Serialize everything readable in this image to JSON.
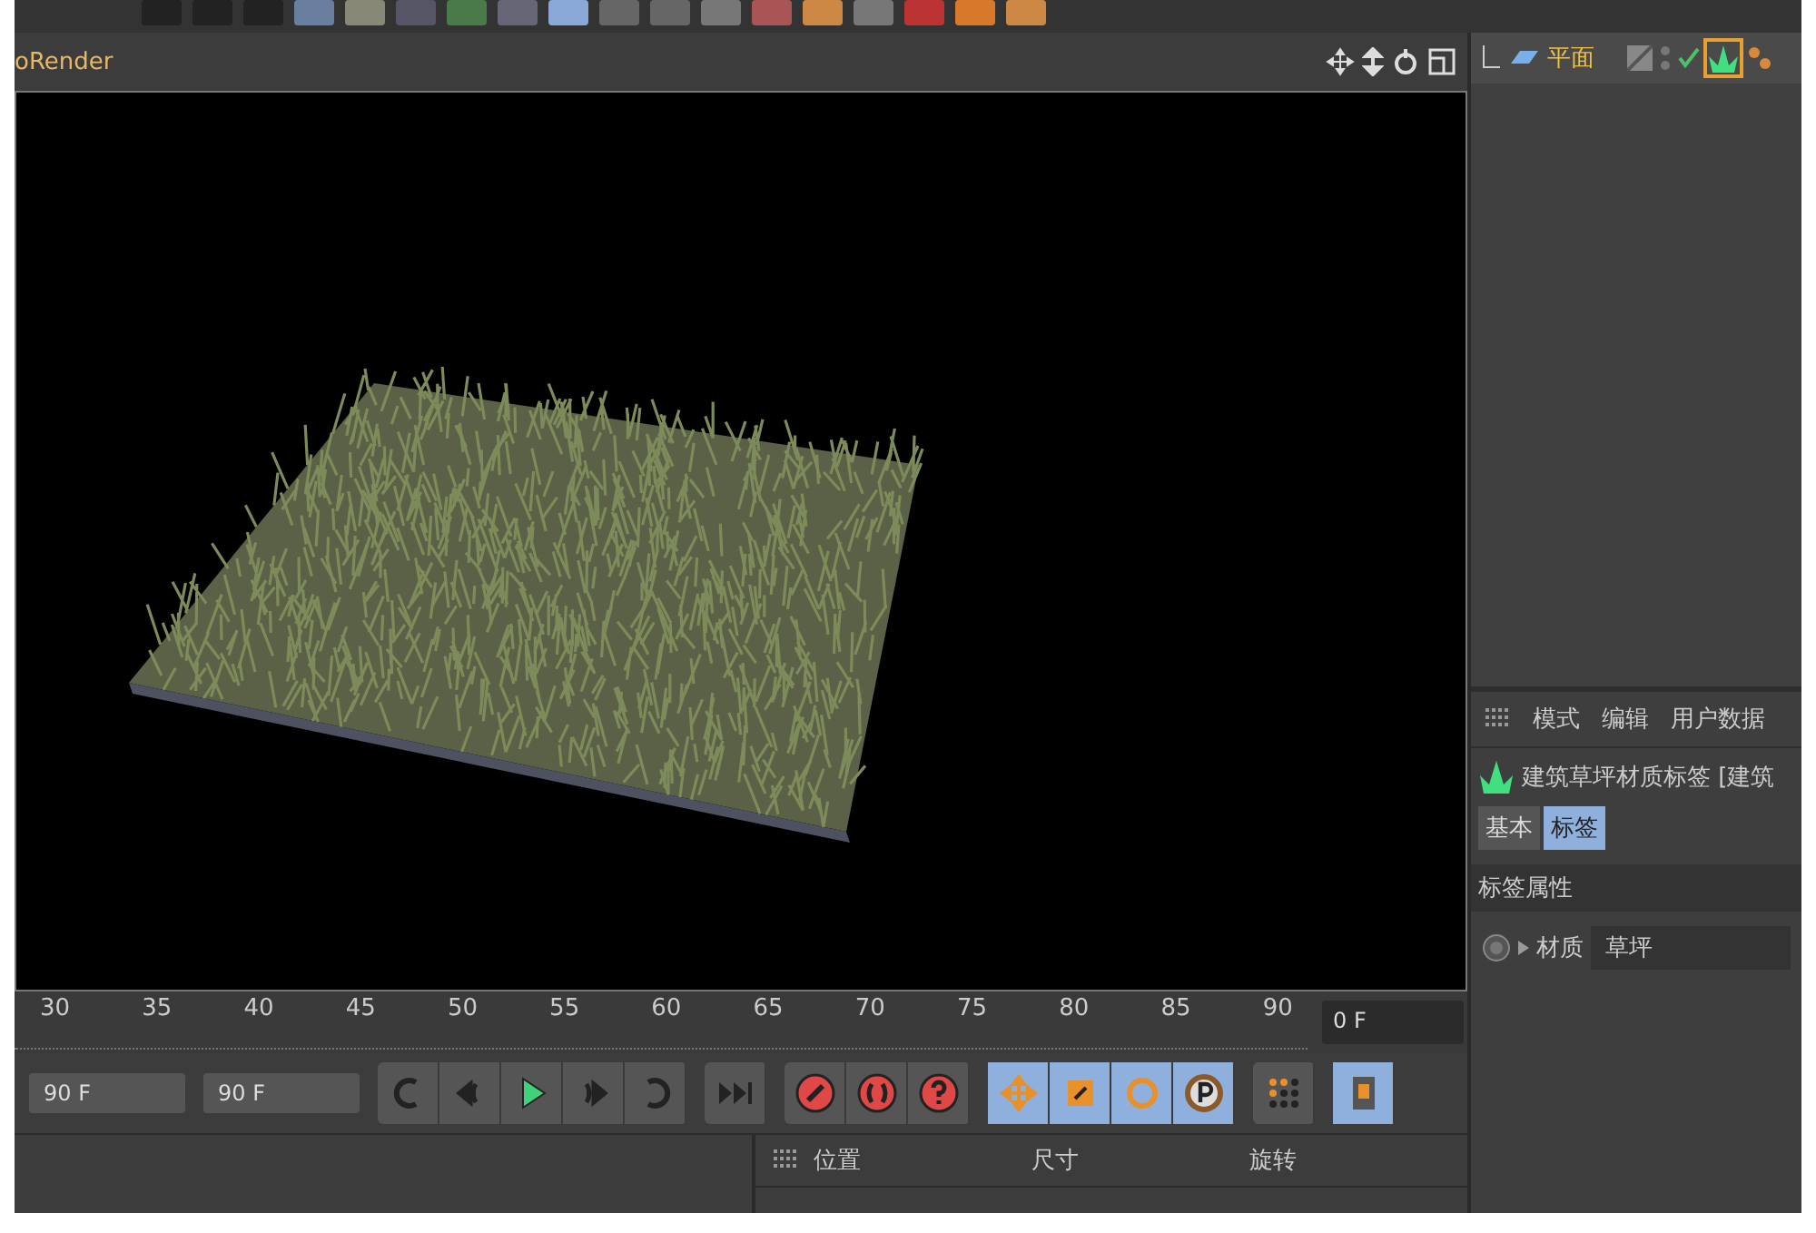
{
  "viewport": {
    "title": "oRender"
  },
  "timeline": {
    "ticks": [
      "30",
      "35",
      "40",
      "45",
      "50",
      "55",
      "60",
      "65",
      "70",
      "75",
      "80",
      "85",
      "90"
    ],
    "current_frame": "0 F"
  },
  "playback": {
    "start_frame": "90 F",
    "end_frame": "90 F"
  },
  "coordinates": {
    "columns": [
      "位置",
      "尺寸",
      "旋转"
    ]
  },
  "object_manager": {
    "objects": [
      {
        "name": "平面",
        "selected": true
      }
    ]
  },
  "attributes": {
    "menu": [
      "模式",
      "编辑",
      "用户数据"
    ],
    "title": "建筑草坪材质标签 [建筑",
    "tabs": [
      {
        "label": "基本",
        "selected": false
      },
      {
        "label": "标签",
        "selected": true
      }
    ],
    "section": "标签属性",
    "fields": [
      {
        "label": "材质",
        "value": "草坪"
      }
    ]
  }
}
